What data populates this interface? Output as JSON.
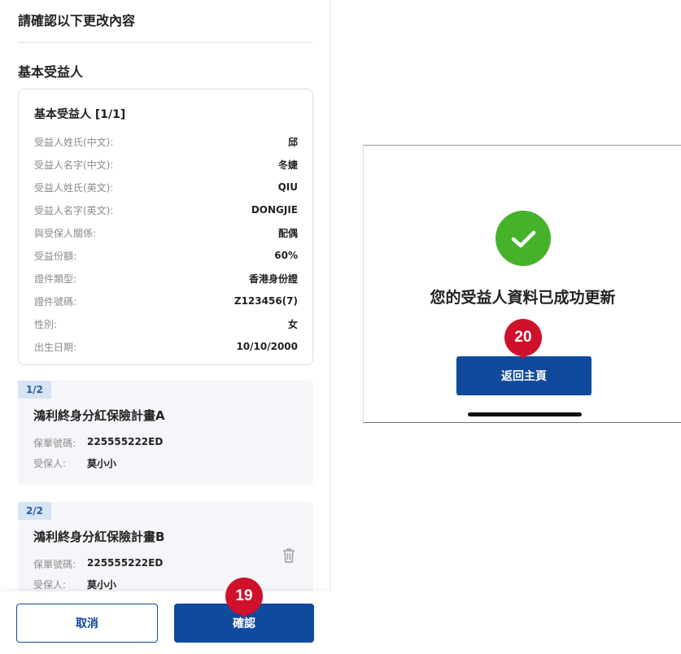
{
  "confirm_screen": {
    "header": "請確認以下更改內容",
    "section_title": "基本受益人",
    "beneficiary_card": {
      "title": "基本受益人 [1/1]",
      "rows": [
        {
          "label": "受益人姓氏(中文):",
          "value": "邱"
        },
        {
          "label": "受益人名字(中文):",
          "value": "冬婕"
        },
        {
          "label": "受益人姓氏(英文):",
          "value": "QIU"
        },
        {
          "label": "受益人名字(英文):",
          "value": "DONGJIE"
        },
        {
          "label": "與受保人關係:",
          "value": "配偶"
        },
        {
          "label": "受益份額:",
          "value": "60%"
        },
        {
          "label": "證件類型:",
          "value": "香港身份證"
        },
        {
          "label": "證件號碼:",
          "value": "Z123456(7)"
        },
        {
          "label": "性別:",
          "value": "女"
        },
        {
          "label": "出生日期:",
          "value": "10/10/2000"
        }
      ]
    },
    "policies": [
      {
        "badge": "1/2",
        "name": "鴻利終身分紅保險計畫A",
        "policy_no_label": "保單號碼:",
        "policy_no": "225555222ED",
        "insured_label": "受保人:",
        "insured": "莫小小"
      },
      {
        "badge": "2/2",
        "name": "鴻利終身分紅保險計畫B",
        "policy_no_label": "保單號碼:",
        "policy_no": "225555222ED",
        "insured_label": "受保人:",
        "insured": "莫小小"
      }
    ],
    "buttons": {
      "cancel": "取消",
      "confirm": "確認"
    },
    "step_badge": "19"
  },
  "success_screen": {
    "message": "您的受益人資料已成功更新",
    "home_button": "返回主頁",
    "step_badge": "20"
  },
  "colors": {
    "primary": "#0f4a9c",
    "success": "#46b22c",
    "step_badge": "#d0112b",
    "policy_badge_bg": "#d6e4f4"
  },
  "icons": [
    "check-icon",
    "trash-icon"
  ]
}
